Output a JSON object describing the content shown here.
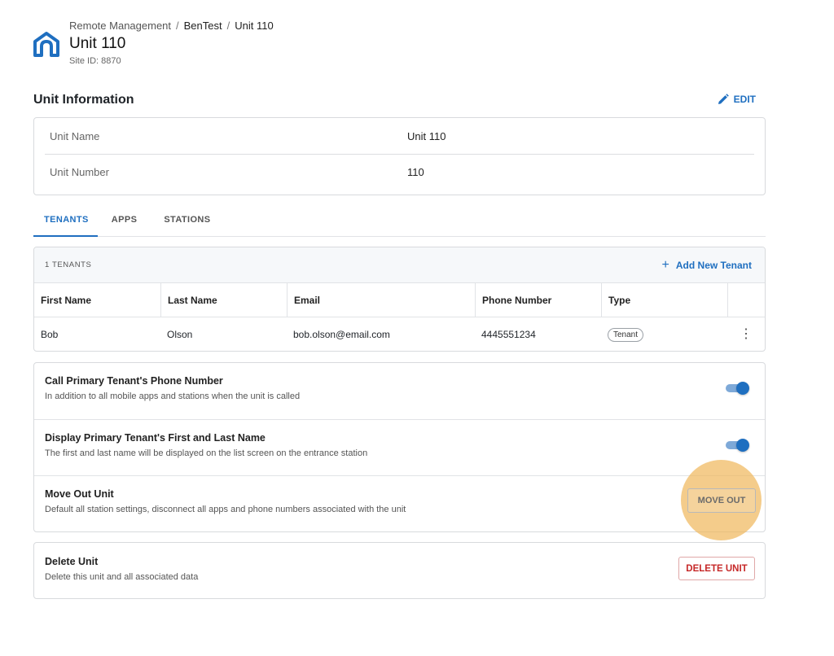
{
  "breadcrumb": {
    "root": "Remote Management",
    "site": "BenTest",
    "current": "Unit 110",
    "separator": "/"
  },
  "page": {
    "title": "Unit 110",
    "site_id": "Site ID: 8870"
  },
  "unit_info": {
    "title": "Unit Information",
    "edit_label": "EDIT",
    "rows": [
      {
        "label": "Unit Name",
        "value": "Unit 110"
      },
      {
        "label": "Unit Number",
        "value": "110"
      }
    ]
  },
  "tabs": [
    {
      "label": "TENANTS",
      "active": true
    },
    {
      "label": "APPS",
      "active": false
    },
    {
      "label": "STATIONS",
      "active": false
    }
  ],
  "tenants": {
    "count_label": "1 TENANTS",
    "add_label": "Add New Tenant",
    "columns": [
      "First Name",
      "Last Name",
      "Email",
      "Phone Number",
      "Type"
    ],
    "rows": [
      {
        "first": "Bob",
        "last": "Olson",
        "email": "bob.olson@email.com",
        "phone": "4445551234",
        "type": "Tenant"
      }
    ]
  },
  "settings": [
    {
      "title": "Call Primary Tenant's Phone Number",
      "desc": "In addition to all mobile apps and stations when the unit is called",
      "enabled": true
    },
    {
      "title": "Display Primary Tenant's First and Last Name",
      "desc": "The first and last name will be displayed on the list screen on the entrance station",
      "enabled": true
    },
    {
      "title": "Move Out Unit",
      "desc": "Default all station settings, disconnect all apps and phone numbers associated with the unit",
      "button": "MOVE OUT"
    }
  ],
  "delete": {
    "title": "Delete Unit",
    "desc": "Delete this unit and all associated data",
    "button": "DELETE UNIT"
  },
  "colors": {
    "accent": "#1f6fc0",
    "danger": "#c62828",
    "highlight": "#f0b75a"
  }
}
